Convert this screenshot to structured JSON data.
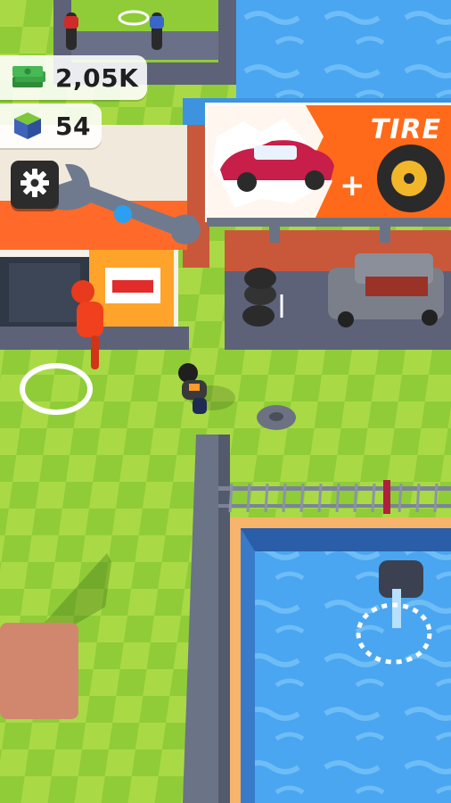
{
  "hud": {
    "cash": {
      "icon": "cash-stack-icon",
      "value": "2,05K"
    },
    "cubes": {
      "icon": "grass-cube-icon",
      "value": "54"
    },
    "settings": {
      "icon": "gear-icon"
    }
  },
  "billboard": {
    "text": "TIRE",
    "plus": "+",
    "items": [
      "red-car-icon",
      "tire-icon"
    ]
  },
  "colors": {
    "grass_light": "#a7d944",
    "grass_dark": "#8ecb3a",
    "water": "#4aa6f0",
    "accent_orange": "#ff6a1a",
    "road": "#5d6278"
  }
}
